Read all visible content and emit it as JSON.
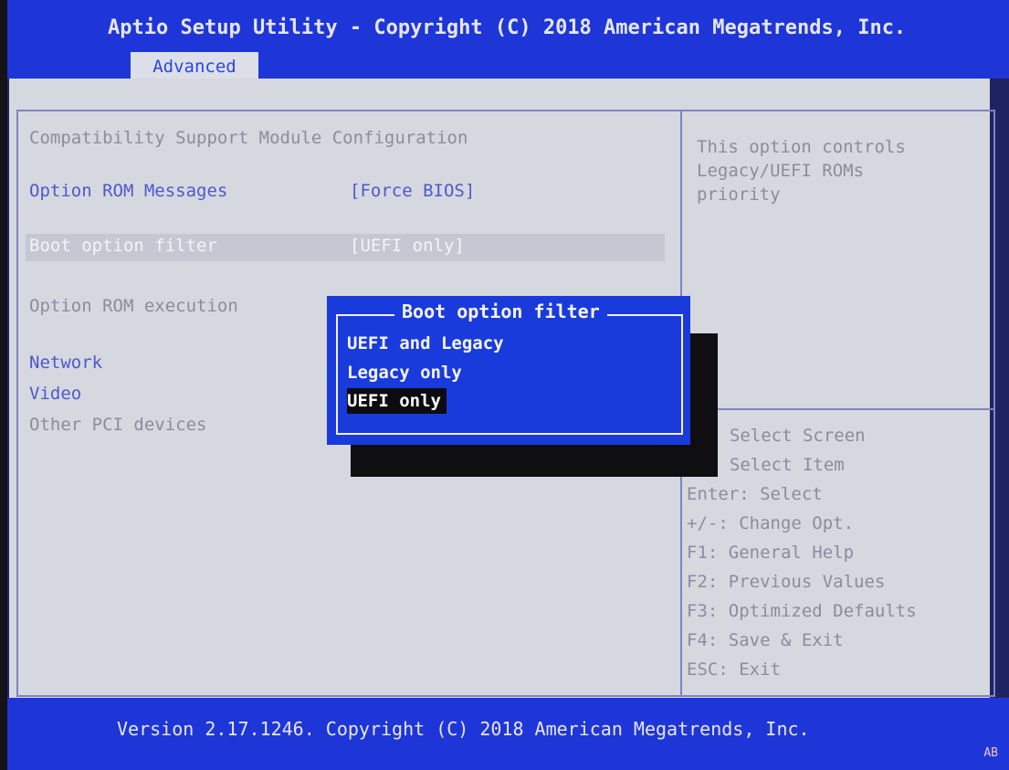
{
  "header": {
    "title": "Aptio Setup Utility - Copyright (C) 2018 American Megatrends, Inc.",
    "active_tab": "Advanced"
  },
  "settings": {
    "section_title": "Compatibility Support Module Configuration",
    "items": [
      {
        "label": "Option ROM Messages",
        "value": "[Force BIOS]"
      },
      {
        "label": "Boot option filter",
        "value": "[UEFI only]"
      },
      {
        "label": "Option ROM execution",
        "value": ""
      }
    ],
    "submenus": [
      "Network",
      "Video",
      "Other PCI devices"
    ]
  },
  "help": {
    "text": [
      "This option controls",
      "Legacy/UEFI ROMs",
      "priority"
    ]
  },
  "popup": {
    "title": "Boot option filter",
    "options": [
      "UEFI and Legacy",
      "Legacy only",
      "UEFI only"
    ],
    "selected": "UEFI only"
  },
  "keys": [
    ": Select Screen",
    ": Select Item",
    "Enter: Select",
    "+/-: Change Opt.",
    "F1: General Help",
    "F2: Previous Values",
    "F3: Optimized Defaults",
    "F4: Save & Exit",
    "ESC: Exit"
  ],
  "footer": {
    "version": "Version 2.17.1246. Copyright (C) 2018 American Megatrends, Inc.",
    "code": "AB"
  },
  "colors": {
    "header_blue": "#1e36d8",
    "panel_gray": "#d6d8e0",
    "popup_blue": "#1a3bdb",
    "option_blue": "#4d59cc"
  }
}
